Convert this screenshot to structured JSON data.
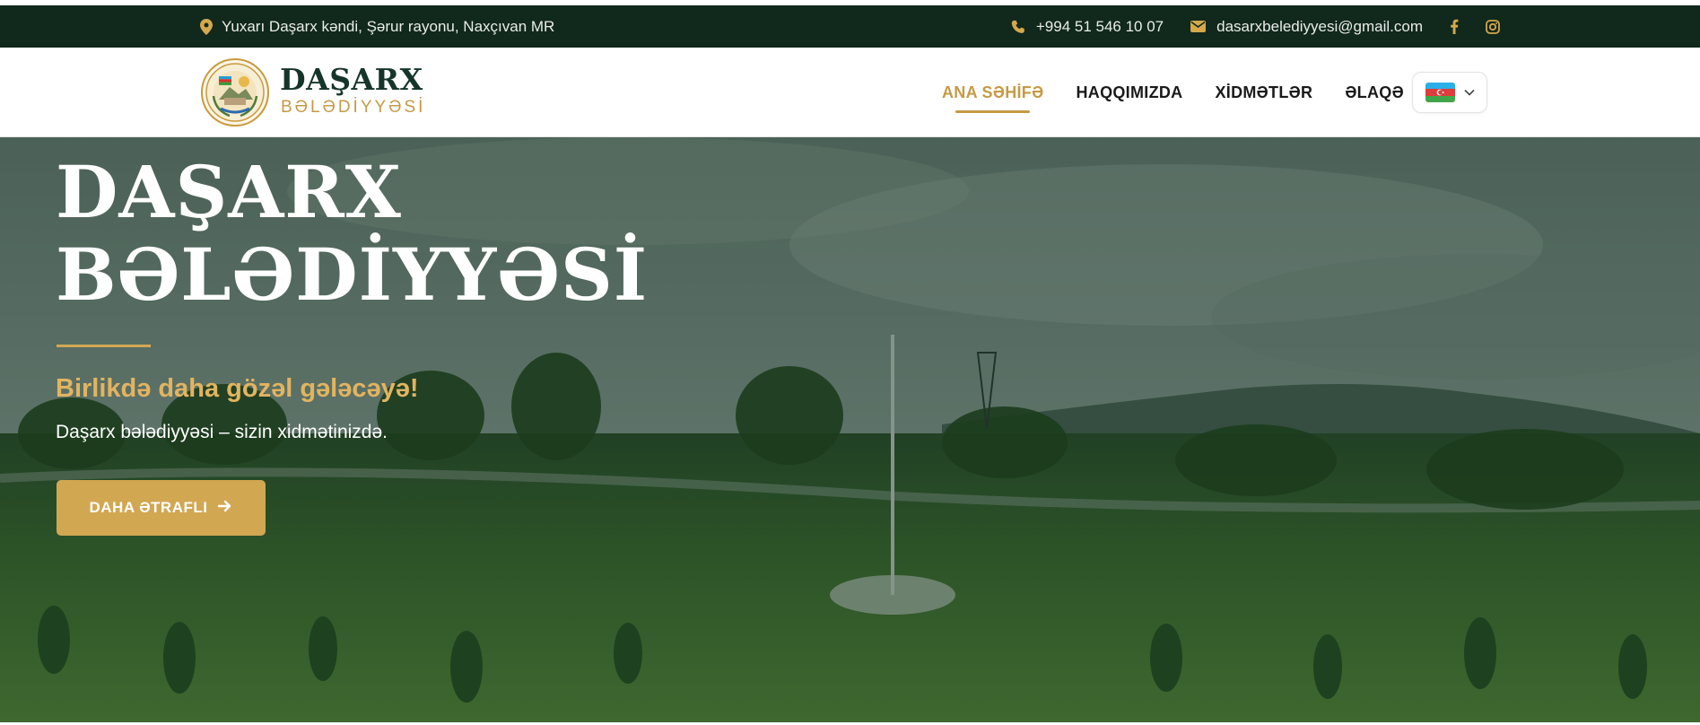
{
  "topbar": {
    "address": "Yuxarı Daşarx kəndi, Şərur rayonu, Naxçıvan MR",
    "phone": "+994 51 546 10 07",
    "email": "dasarxbelediyyesi@gmail.com",
    "icons": [
      "location-pin-icon",
      "phone-icon",
      "envelope-icon",
      "facebook-icon",
      "instagram-icon"
    ]
  },
  "logo": {
    "title": "DAŞARX",
    "subtitle": "BƏLƏDİYYƏSİ"
  },
  "nav": {
    "items": [
      {
        "label": "ANA SƏHİFƏ",
        "active": true
      },
      {
        "label": "HAQQIMIZDA",
        "active": false
      },
      {
        "label": "XİDMƏTLƏR",
        "active": false
      },
      {
        "label": "ƏLAQƏ",
        "active": false
      }
    ],
    "language": {
      "flag": "azerbaijan-flag-icon",
      "dropdown_icon": "chevron-down-icon"
    }
  },
  "hero": {
    "title_line1": "DAŞARX",
    "title_line2": "BƏLƏDİYYƏSİ",
    "slogan": "Birlikdə daha gözəl gələcəyə!",
    "text": "Daşarx bələdiyyəsi – sizin xidmətinizdə.",
    "button_label": "DAHA ƏTRAFLI",
    "button_icon": "arrow-right-icon"
  },
  "colors": {
    "topbar_bg": "#11281c",
    "accent_gold": "#c69a44",
    "brand_green": "#16352a",
    "hero_button": "#d2a752"
  }
}
